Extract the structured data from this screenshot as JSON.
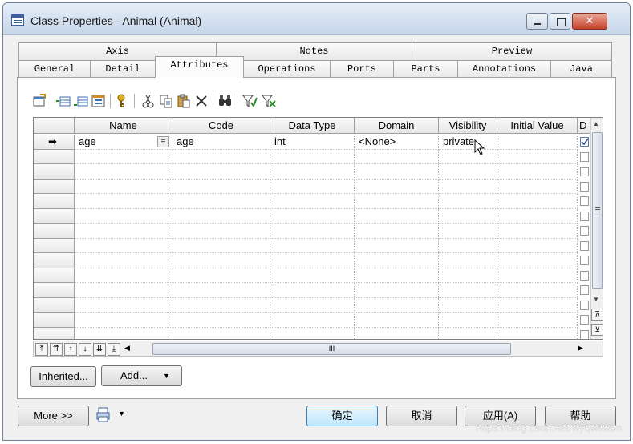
{
  "window": {
    "title": "Class Properties - Animal (Animal)"
  },
  "tabs": {
    "row1": [
      "Axis",
      "Notes",
      "Preview"
    ],
    "row2": [
      "General",
      "Detail",
      "Attributes",
      "Operations",
      "Ports",
      "Parts",
      "Annotations",
      "Java"
    ],
    "active": "Attributes"
  },
  "grid": {
    "columns": [
      "Name",
      "Code",
      "Data Type",
      "Domain",
      "Visibility",
      "Initial Value",
      "D"
    ],
    "rows": [
      {
        "name": "age",
        "code": "age",
        "data_type": "int",
        "domain": "<None>",
        "visibility": "private",
        "checked": true
      }
    ],
    "empty_rows": 13,
    "row_marker": "➡",
    "scroll_label": "III"
  },
  "buttons": {
    "inherited": "Inherited...",
    "add": "Add...",
    "more": "More >>",
    "ok": "确定",
    "cancel": "取消",
    "apply": "应用(A)",
    "help": "帮助"
  },
  "watermark": "https://blog.csdn.net/wyqwilliam"
}
